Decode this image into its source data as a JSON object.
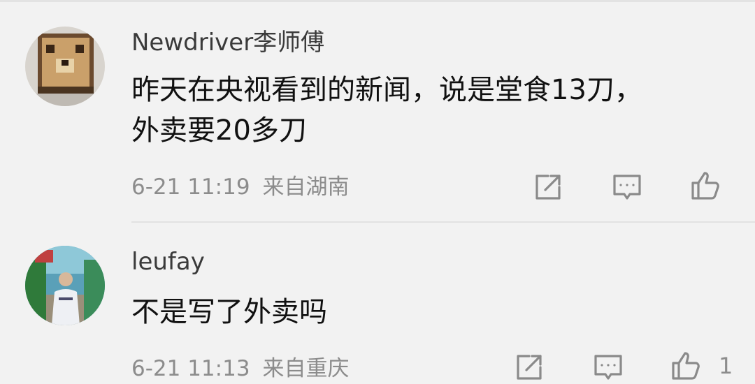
{
  "comments": [
    {
      "username": "Newdriver李师傅",
      "text": "昨天在央视看到的新闻，说是堂食13刀，\n外卖要20多刀",
      "date": "6-21 11:19",
      "location": "来自湖南",
      "like_count": ""
    },
    {
      "username": "leufay",
      "text": "不是写了外卖吗",
      "date": "6-21 11:13",
      "location": "来自重庆",
      "like_count": "1"
    }
  ],
  "icons": {
    "share": "share-icon",
    "reply": "comment-icon",
    "like": "thumbs-up-icon"
  },
  "colors": {
    "background": "#f2f2f2",
    "username": "#3a3a3a",
    "text": "#111111",
    "meta": "#8c8c8c",
    "icon": "#8a8a8a"
  }
}
